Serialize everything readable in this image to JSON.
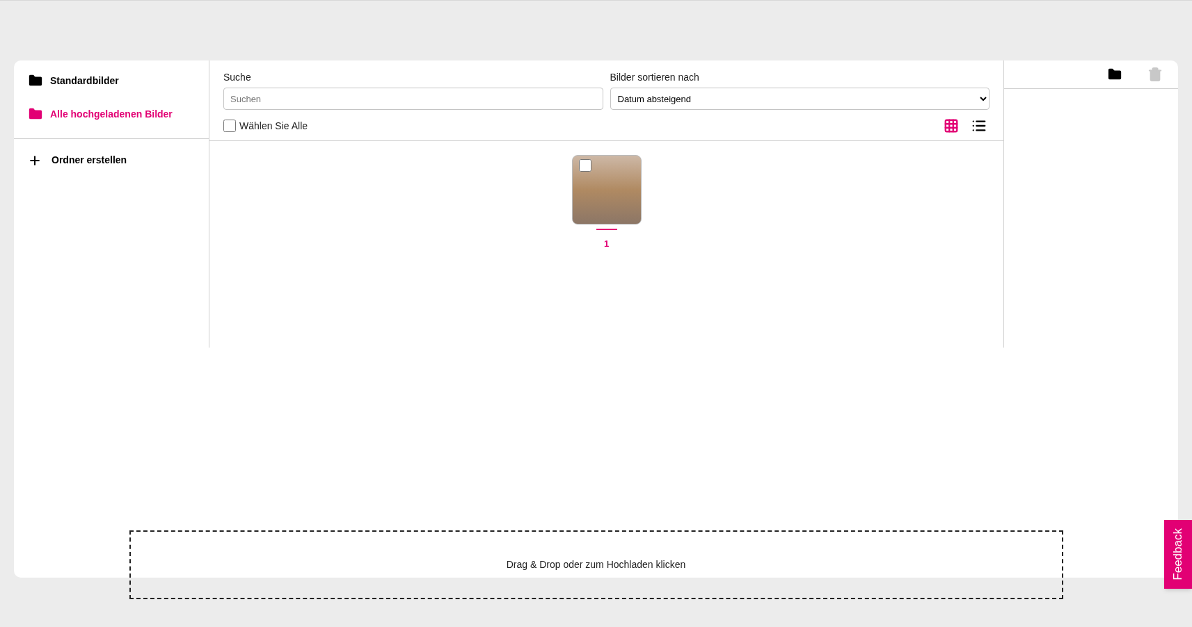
{
  "sidebar": {
    "folders": [
      {
        "label": "Standardbilder",
        "selected": false
      },
      {
        "label": "Alle hochgeladenen Bilder",
        "selected": true
      }
    ],
    "create_folder": "Ordner erstellen"
  },
  "search": {
    "label": "Suche",
    "placeholder": "Suchen"
  },
  "sort": {
    "label": "Bilder sortieren nach",
    "value": "Datum absteigend"
  },
  "select_all": {
    "label": "Wählen Sie Alle",
    "checked": false
  },
  "view_modes": [
    {
      "kind": "grid",
      "selected": true
    },
    {
      "kind": "list",
      "selected": false
    }
  ],
  "actions": [
    {
      "kind": "folder",
      "disabled": false
    },
    {
      "kind": "trash",
      "disabled": true
    }
  ],
  "images": [
    {
      "caption": "1",
      "checked": false
    }
  ],
  "dropzone": "Drag & Drop oder zum Hochladen klicken",
  "feedback": "Feedback"
}
